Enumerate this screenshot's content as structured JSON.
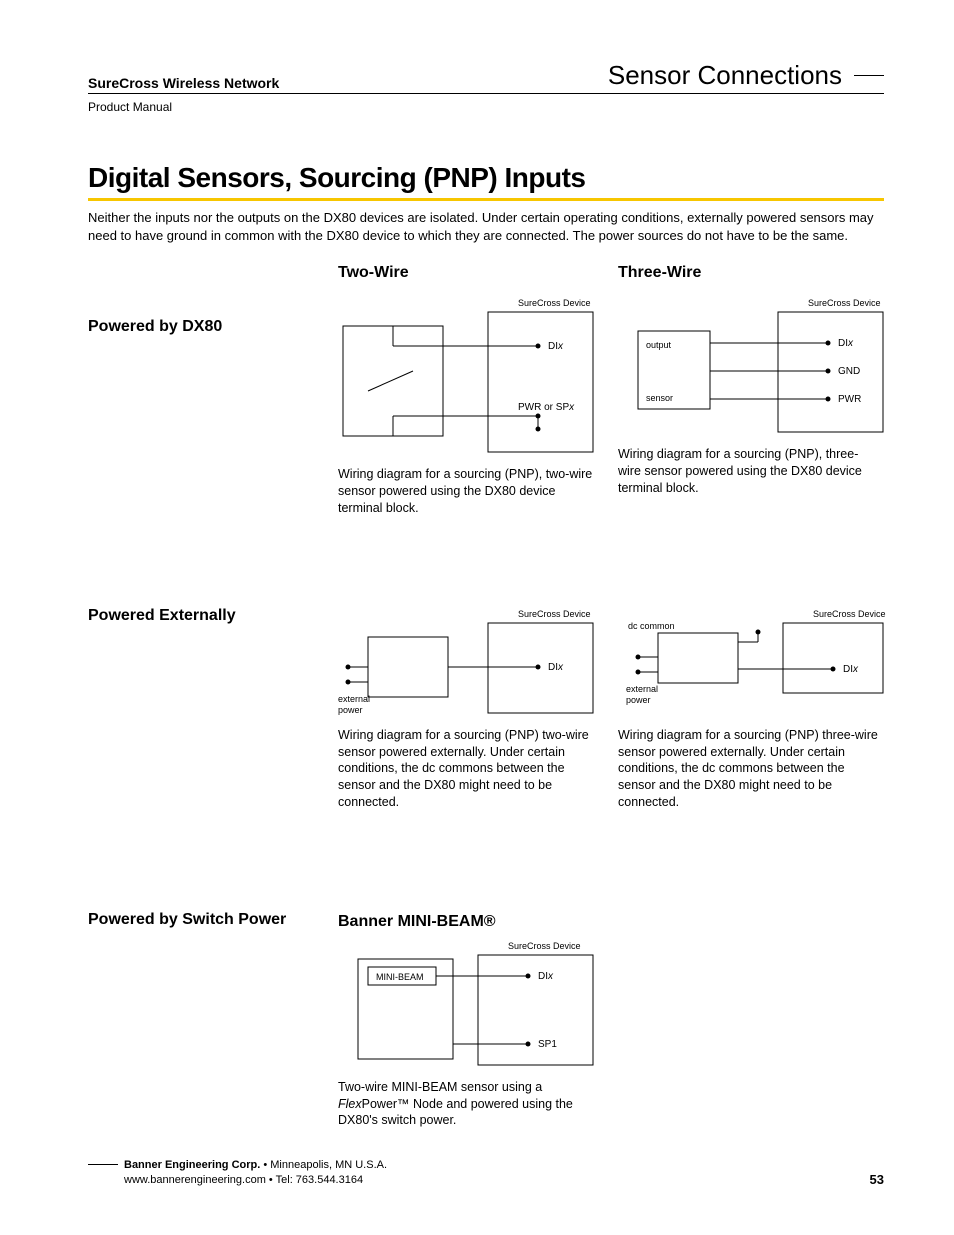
{
  "header": {
    "network": "SureCross Wireless Network",
    "manual": "Product Manual",
    "section": "Sensor Connections"
  },
  "title": "Digital Sensors, Sourcing (PNP) Inputs",
  "intro": "Neither the inputs nor the outputs on the DX80 devices are isolated. Under certain operating conditions, externally powered sensors may need to have ground in common with the DX80 device to which they are connected. The power sources do not have to be the same.",
  "cols": {
    "two": "Two-Wire",
    "three": "Three-Wire"
  },
  "rows": {
    "dx80": "Powered by DX80",
    "ext": "Powered Externally",
    "sp": "Powered by Switch Power",
    "minibeam": "Banner MINI-BEAM®"
  },
  "diagrams": {
    "device": "SureCross Device",
    "dix_pre": "DI",
    "dix_suf": "x",
    "pwr_or_sp_pre": "PWR or SP",
    "pwr_or_sp_suf": "x",
    "output": "output",
    "sensor": "sensor",
    "gnd": "GND",
    "pwr": "PWR",
    "ext_power1": "external",
    "ext_power2": "power",
    "dc_common": "dc common",
    "minibeam": "MINI-BEAM",
    "sp1": "SP1"
  },
  "captions": {
    "a": "Wiring diagram for a sourcing (PNP), two-wire sensor powered using the DX80 device terminal block.",
    "b": "Wiring diagram for a sourcing (PNP), three-wire sensor powered using the DX80 device terminal block.",
    "c": "Wiring diagram for a sourcing (PNP) two-wire sensor powered externally. Under certain conditions, the dc commons between the sensor and the DX80 might need to be connected.",
    "d": "Wiring diagram for a sourcing (PNP) three-wire sensor powered externally. Under certain conditions, the dc commons between the sensor and the DX80 might need to be connected.",
    "e_pre": "Two-wire MINI-BEAM sensor using a ",
    "e_flex": "Flex",
    "e_post": "Power™ Node and powered using the DX80's switch power."
  },
  "footer": {
    "company": "Banner Engineering Corp.",
    "loc": " •  Minneapolis, MN U.S.A.",
    "web": "www.bannerengineering.com  •  Tel: 763.544.3164",
    "page": "53"
  }
}
